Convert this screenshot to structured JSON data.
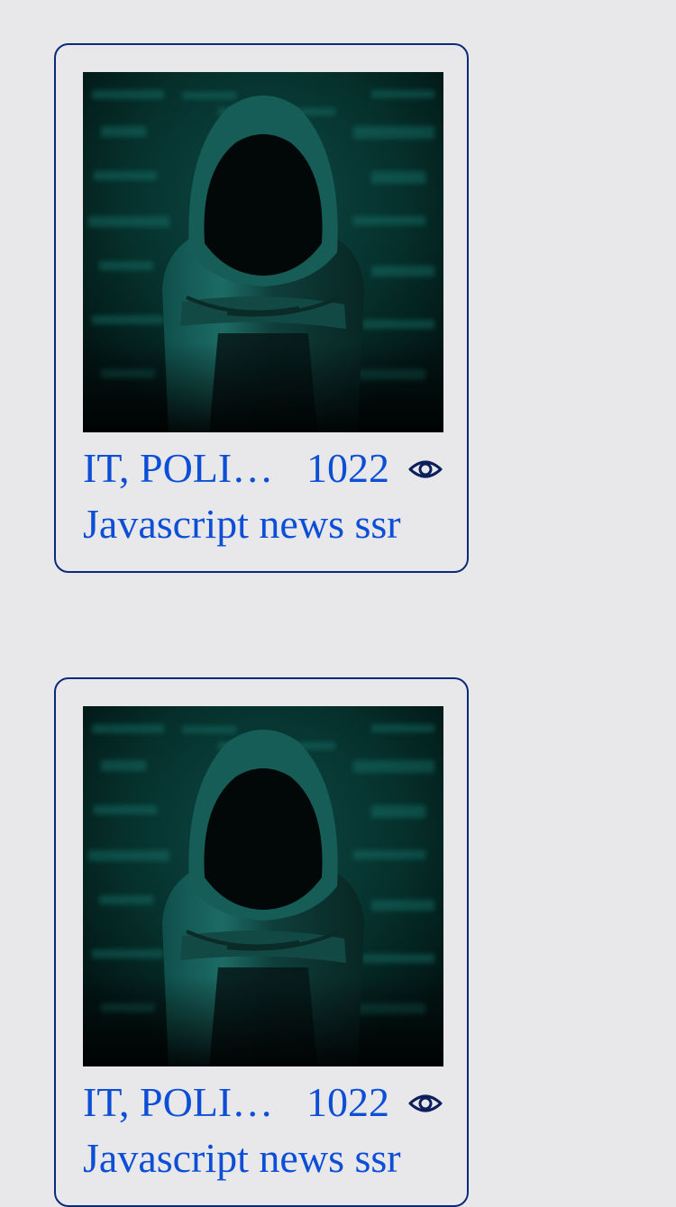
{
  "feed": {
    "cards": [
      {
        "image": "hooded-hacker-image",
        "category": "IT, POLITICS",
        "views": "1022",
        "views_icon": "eye-icon",
        "title": "Javascript news ssr"
      },
      {
        "image": "hooded-hacker-image",
        "category": "IT, POLITICS",
        "views": "1022",
        "views_icon": "eye-icon",
        "title": "Javascript news ssr"
      }
    ]
  },
  "colors": {
    "background": "#e8e8eb",
    "card_border": "#0b2a7a",
    "link_text": "#0c4fd6",
    "icon": "#0b1f5a"
  }
}
